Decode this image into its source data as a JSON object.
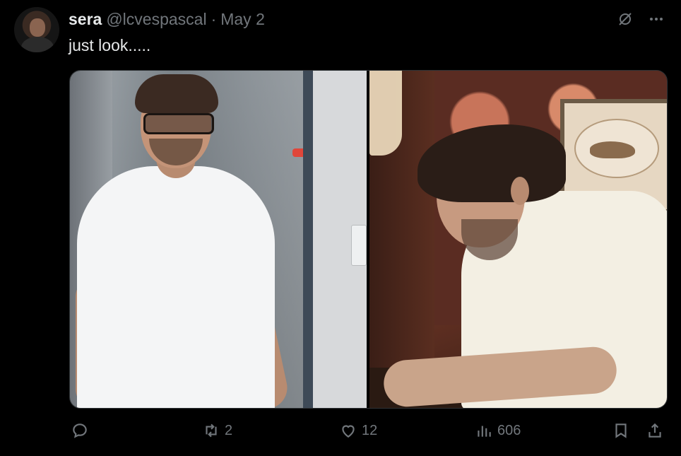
{
  "user": {
    "name": "sera",
    "handle": "@lcvespascal",
    "separator": "·",
    "date": "May 2"
  },
  "tweet": {
    "text": "just look....."
  },
  "top_icons": [
    "grok-icon",
    "more-icon"
  ],
  "media": {
    "count": 2
  },
  "actions": {
    "reply": {
      "icon": "reply-icon",
      "count": ""
    },
    "retweet": {
      "icon": "retweet-icon",
      "count": "2"
    },
    "like": {
      "icon": "heart-icon",
      "count": "12"
    },
    "views": {
      "icon": "views-icon",
      "count": "606"
    },
    "bookmark": {
      "icon": "bookmark-icon"
    },
    "share": {
      "icon": "share-icon"
    }
  },
  "colors": {
    "background": "#000000",
    "text": "#e7e9ea",
    "muted": "#71767b"
  }
}
